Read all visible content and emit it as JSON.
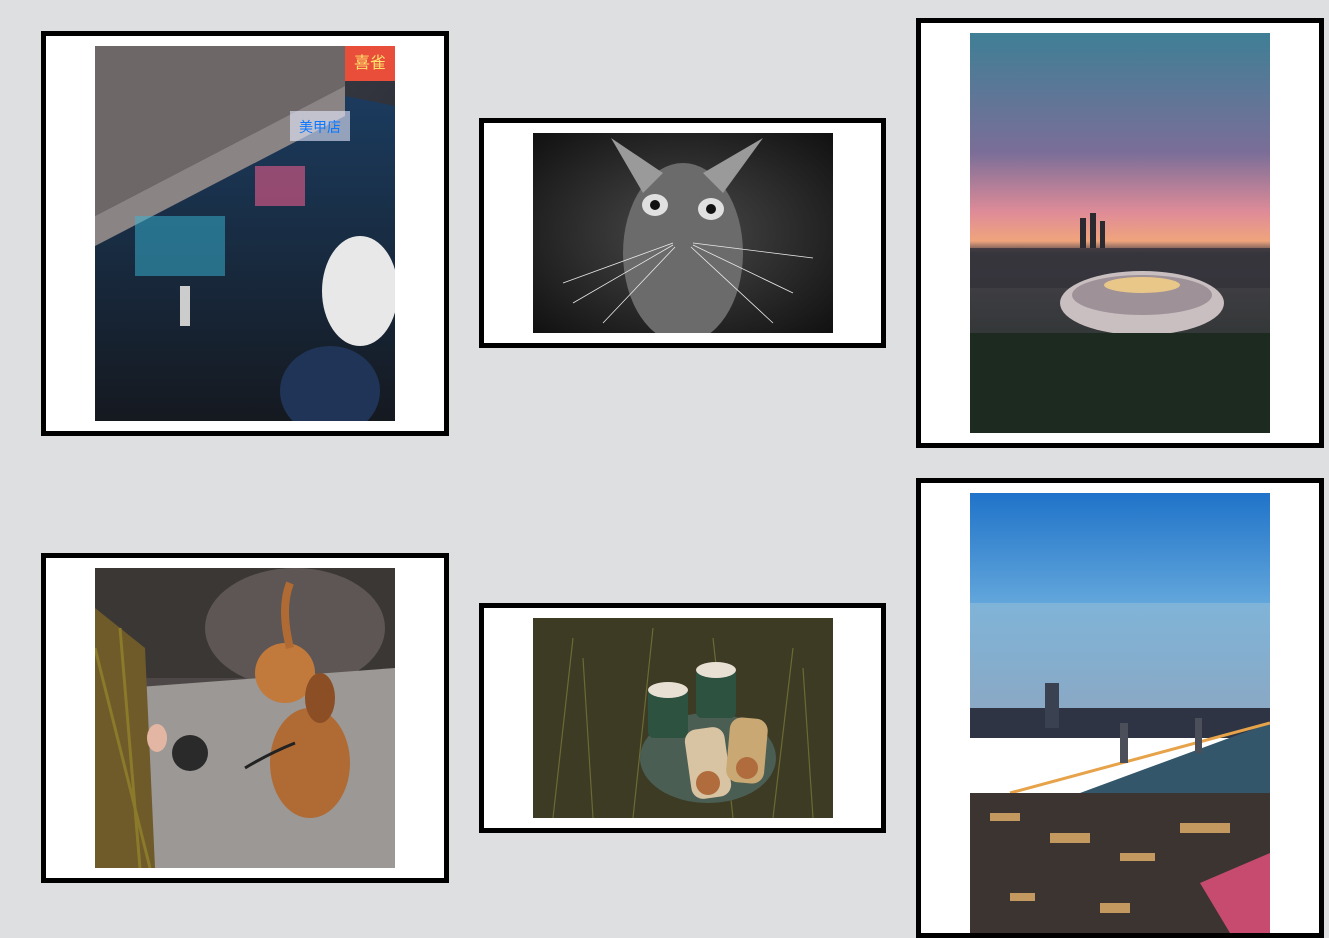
{
  "gallery": {
    "background_color": "#dedfe1",
    "frame_color": "#000000",
    "mat_color": "#ffffff",
    "photos": [
      {
        "subject": "neon-street-night-photo",
        "signs": {
          "top": "喜雀",
          "middle": "美甲店"
        }
      },
      {
        "subject": "black-white-cat-photo"
      },
      {
        "subject": "stadium-sunset-cityscape-photo"
      },
      {
        "subject": "dachshund-on-leash-photo"
      },
      {
        "subject": "coffee-picnic-on-grass-photo"
      },
      {
        "subject": "bridge-city-dusk-aerial-photo"
      }
    ]
  }
}
